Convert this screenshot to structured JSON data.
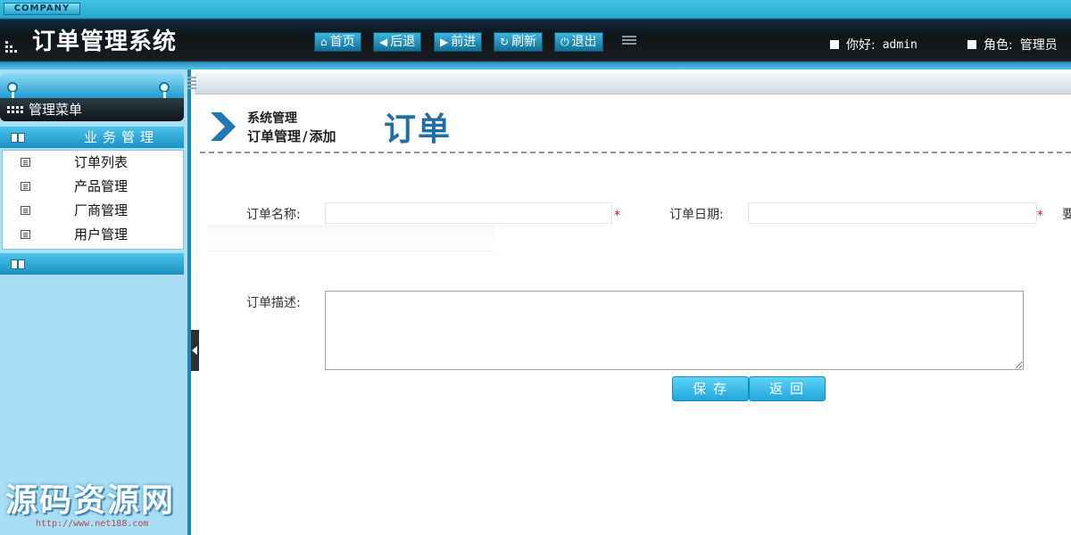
{
  "header": {
    "company": "COMPANY",
    "title": "订单管理系统",
    "nav": [
      {
        "label": "首页",
        "icon": "home-icon"
      },
      {
        "label": "后退",
        "icon": "arrow-left-icon"
      },
      {
        "label": "前进",
        "icon": "arrow-right-icon"
      },
      {
        "label": "刷新",
        "icon": "refresh-icon"
      },
      {
        "label": "退出",
        "icon": "power-icon"
      }
    ],
    "greeting_label": "你好:",
    "greeting_user": "admin",
    "role_label": "角色:",
    "role_value": "管理员"
  },
  "sidebar": {
    "menu_title": "管理菜单",
    "section1_title": "业务管理",
    "items": [
      {
        "label": "订单列表"
      },
      {
        "label": "产品管理"
      },
      {
        "label": "厂商管理"
      },
      {
        "label": "用户管理"
      }
    ],
    "section2_title": ""
  },
  "content": {
    "breadcrumb_top": "系统管理",
    "breadcrumb_parent": "订单管理",
    "breadcrumb_sep": "/",
    "breadcrumb_current": "添加",
    "page_title": "订单",
    "form": {
      "name_label": "订单名称:",
      "name_value": "",
      "date_label": "订单日期:",
      "date_value": "",
      "required_mark": "*",
      "desc_label": "订单描述:",
      "desc_value": "",
      "cut_label": "要"
    },
    "buttons": {
      "save": "保存",
      "back": "返回"
    }
  },
  "watermark": {
    "text": "源码资源网",
    "url": "http://www.net188.com"
  },
  "colors": {
    "accent": "#1f9cd0",
    "title_blue": "#1f6ea4",
    "required": "#cc1111"
  }
}
